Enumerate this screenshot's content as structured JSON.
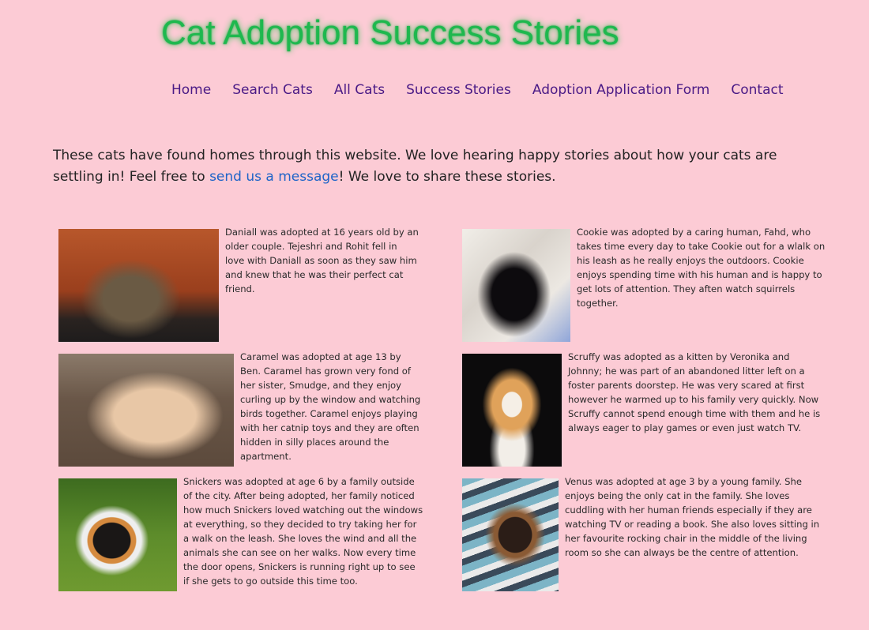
{
  "header": {
    "title": "Cat Adoption Success Stories"
  },
  "nav": {
    "items": [
      {
        "label": "Home"
      },
      {
        "label": "Search Cats"
      },
      {
        "label": "All Cats"
      },
      {
        "label": "Success Stories"
      },
      {
        "label": "Adoption Application Form"
      },
      {
        "label": "Contact"
      }
    ]
  },
  "intro": {
    "text_before_link": "These cats have found homes through this website. We love hearing happy stories about how your cats are settling in! Feel free to ",
    "link_text": "send us a message",
    "text_after_link": "! We love to share these stories."
  },
  "stories": [
    {
      "name": "Daniall",
      "photo_icon": "cat-photo",
      "text": "Daniall was adopted at 16 years old by an older couple. Tejeshri and Rohit fell in love with Daniall as soon as they saw him and knew that he was their perfect cat friend."
    },
    {
      "name": "Cookie",
      "photo_icon": "cat-photo",
      "text": "Cookie was adopted by a caring human, Fahd, who takes time every day to take Cookie out for a wlalk on his leash as he really enjoys the outdoors. Cookie enjoys spending time with his human and is happy to get lots of attention. They aften watch squirrels together."
    },
    {
      "name": "Caramel",
      "photo_icon": "cat-photo",
      "text": "Caramel was adopted at age 13 by Ben. Caramel has grown very fond of her sister, Smudge, and they enjoy curling up by the window and watching birds together. Caramel enjoys playing with her catnip toys and they are often hidden in silly places around the apartment."
    },
    {
      "name": "Scruffy",
      "photo_icon": "cat-photo",
      "text": "Scruffy was adopted as a kitten by Veronika and Johnny; he was part of an abandoned litter left on a foster parents doorstep. He was very scared at first however he warmed up to his family very quickly. Now Scruffy cannot spend enough time with them and he is always eager to play games or even just watch TV."
    },
    {
      "name": "Snickers",
      "photo_icon": "cat-photo",
      "text": "Snickers was adopted at age 6 by a family outside of the city. After being adopted, her family noticed how much Snickers loved watching out the windows at everything, so they decided to try taking her for a walk on the leash. She loves the wind and all the animals she can see on her walks. Now every time the door opens, Snickers is running right up to see if she gets to go outside this time too."
    },
    {
      "name": "Venus",
      "photo_icon": "cat-photo",
      "text": "Venus was adopted at age 3 by a young family. She enjoys being the only cat in the family. She loves cuddling with her human friends especially if they are watching TV or reading a book. She also loves sitting in her favourite rocking chair in the middle of the living room so she can always be the centre of attention."
    }
  ],
  "colors": {
    "background": "#fccbd5",
    "title": "#1eb84e",
    "nav_link": "#4a1a86",
    "link": "#1f64c8"
  }
}
